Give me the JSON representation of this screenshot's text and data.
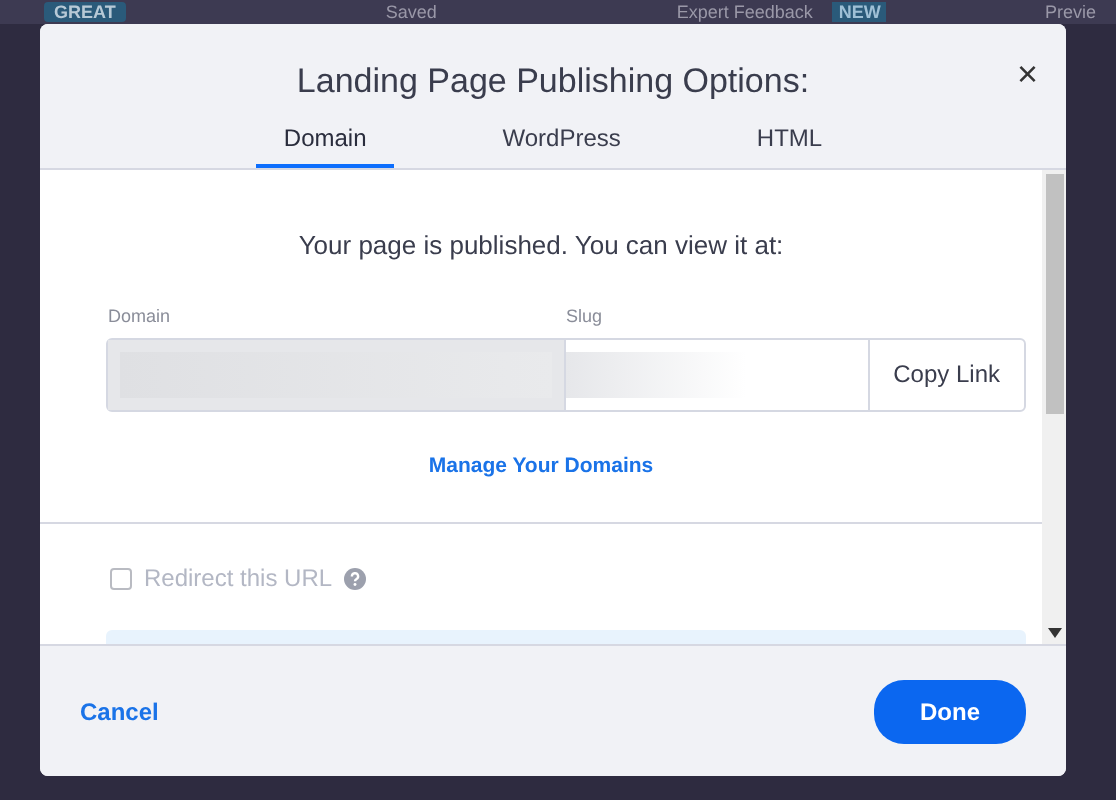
{
  "app_bar": {
    "badge": "GREAT",
    "save_status": "Saved",
    "feedback": "Expert Feedback",
    "feedback_badge": "NEW",
    "preview": "Previe"
  },
  "dialog": {
    "title": "Landing Page Publishing Options:",
    "close": "×",
    "tabs": [
      {
        "label": "Domain",
        "selected": true
      },
      {
        "label": "WordPress",
        "selected": false
      },
      {
        "label": "HTML",
        "selected": false
      }
    ],
    "message": "Your page is published. You can view it at:",
    "domain_label": "Domain",
    "slug_label": "Slug",
    "copy_button": "Copy Link",
    "manage_link": "Manage Your Domains",
    "redirect": {
      "label": "Redirect this URL",
      "checked": false,
      "disabled": true
    },
    "cancel": "Cancel",
    "done": "Done"
  }
}
